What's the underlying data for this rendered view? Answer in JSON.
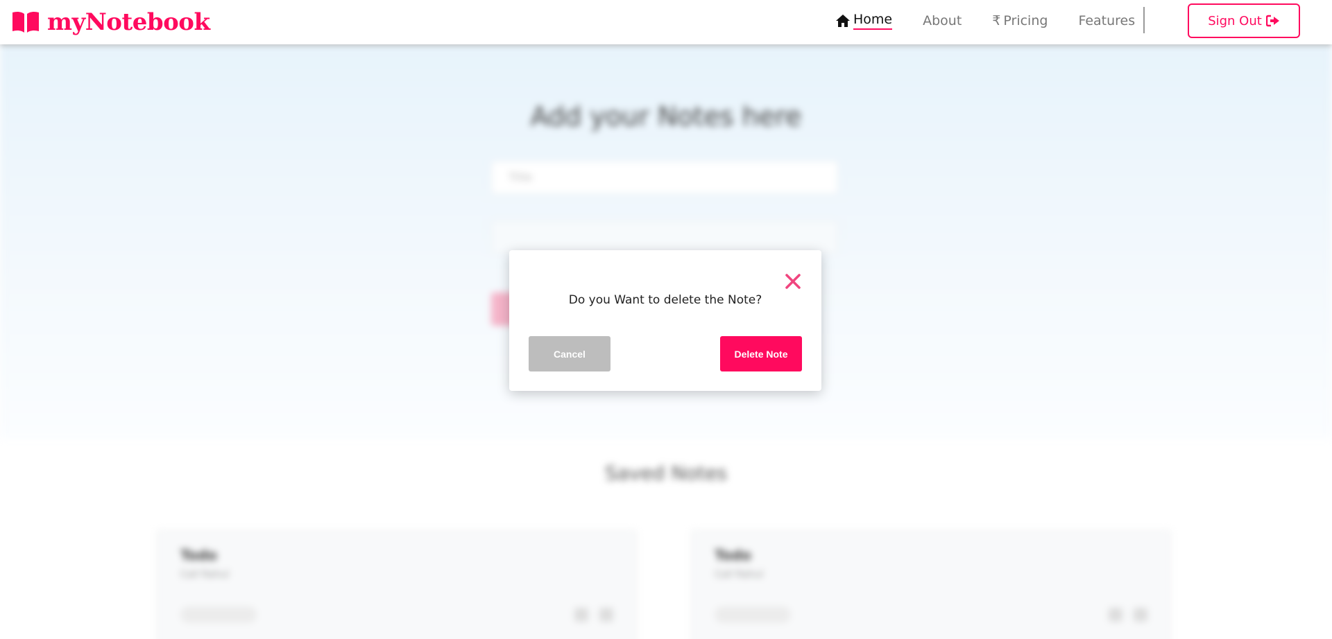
{
  "app": {
    "brand_name": "myNotebook",
    "brand_icon": "book-icon",
    "brand_color": "#ff0a5e"
  },
  "nav": {
    "home_label": "Home",
    "home_icon": "home-icon",
    "about_label": "About",
    "pricing_label": "Pricing",
    "pricing_icon": "₹",
    "features_label": "Features",
    "signout_label": "Sign Out",
    "signout_icon": "sign-out-icon",
    "active_item": "Home"
  },
  "background_page": {
    "hero_title": "Add your Notes here",
    "title_input_placeholder": "Title",
    "saved_notes_title": "Saved Notes",
    "notes": [
      {
        "title": "Todo",
        "description": "Call Rahul"
      },
      {
        "title": "Todo",
        "description": "Call Rahul"
      }
    ]
  },
  "modal": {
    "message": "Do you Want to delete the Note?",
    "cancel_label": "Cancel",
    "delete_label": "Delete Note",
    "close_icon": "close-icon",
    "cancel_color": "#bdbdbd",
    "delete_color": "#ff0a5e"
  }
}
